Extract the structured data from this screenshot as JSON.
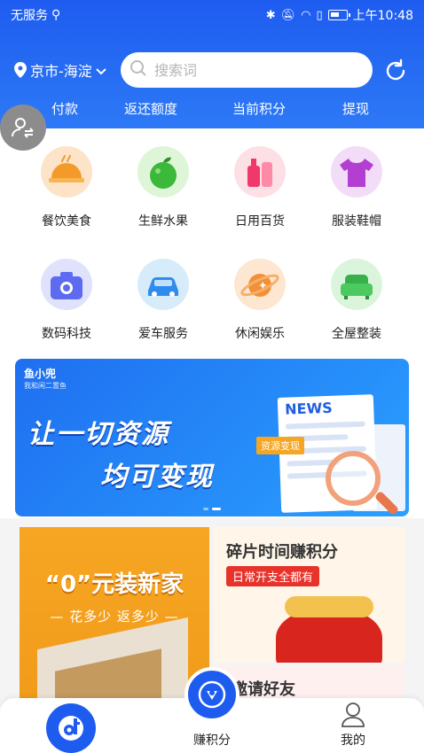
{
  "status_bar": {
    "carrier": "无服务",
    "usb_icon": "usb-icon",
    "time": "上午10:48",
    "icons": [
      "bluetooth-icon",
      "mute-icon",
      "wifi-icon",
      "sim-icon",
      "battery-icon"
    ]
  },
  "header": {
    "location": "京市-海淀",
    "search_placeholder": "搜索词",
    "refresh_icon": "refresh-icon",
    "subnav": [
      "付款",
      "返还额度",
      "当前积分",
      "提现"
    ]
  },
  "categories": [
    {
      "label": "餐饮美食",
      "icon": "dining-icon"
    },
    {
      "label": "生鲜水果",
      "icon": "apple-icon"
    },
    {
      "label": "日用百货",
      "icon": "cosmetics-icon"
    },
    {
      "label": "服装鞋帽",
      "icon": "tshirt-icon"
    },
    {
      "label": "数码科技",
      "icon": "camera-icon"
    },
    {
      "label": "爱车服务",
      "icon": "car-icon"
    },
    {
      "label": "休闲娱乐",
      "icon": "planet-icon"
    },
    {
      "label": "全屋整装",
      "icon": "sofa-icon"
    }
  ],
  "banner": {
    "brand": "鱼小兜",
    "brand_sub": "我和闲二置鱼",
    "line1": "让一切资源",
    "line2": "均可变现",
    "news_label": "NEWS",
    "tag": "资源变现"
  },
  "promos": {
    "left_title": "“0”元装新家",
    "left_sub": "— 花多少 返多少 —",
    "right_title": "碎片时间赚积分",
    "right_tag": "日常开支全都有",
    "bottom_title": "邀请好友"
  },
  "tabbar": {
    "center_label": "赚积分",
    "right_label": "我的"
  },
  "colors": {
    "primary": "#1e5cf0",
    "orange": "#f6a623",
    "red": "#e8332b"
  }
}
